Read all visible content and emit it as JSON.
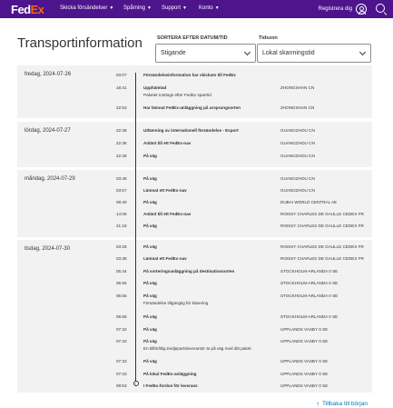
{
  "header": {
    "logo_fed": "Fed",
    "logo_ex": "Ex",
    "nav": [
      "Skicka försändelser",
      "Spårning",
      "Support",
      "Konto"
    ],
    "register": "Registrera dig"
  },
  "page": {
    "title": "Transportinformation",
    "sort_label": "SORTERA EFTER DATUM/TID",
    "sort_value": "Stigande",
    "tz_label": "Tidszon",
    "tz_value": "Lokal skanningstid",
    "back_to_top": "Tillbaka till början"
  },
  "days": [
    {
      "label": "fredag, 2024-07-26",
      "events": [
        {
          "time": "03:07",
          "desc": "Försändelseinformation har skickats till FedEx",
          "loc": ""
        },
        {
          "time": "18:41",
          "desc": "Upphämtad",
          "sub": "Paketet mottogs efter FedEx sparrtid",
          "loc": "ZHONGSHAN CN"
        },
        {
          "time": "22:53",
          "desc": "Har lämnat FedEx-anläggning på ursprungsorten",
          "loc": "ZHONGSHAN CN"
        }
      ]
    },
    {
      "label": "lördag, 2024-07-27",
      "events": [
        {
          "time": "22:38",
          "desc": "Utlämning av internationell försändelse - Export",
          "loc": "GUANGZHOU CN"
        },
        {
          "time": "22:38",
          "desc": "Anlänt till ett FedEx-nav",
          "loc": "GUANGZHOU CN"
        },
        {
          "time": "22:38",
          "desc": "På väg",
          "loc": "GUANGZHOU CN"
        }
      ]
    },
    {
      "label": "måndag, 2024-07-29",
      "events": [
        {
          "time": "03:48",
          "desc": "På väg",
          "loc": "GUANGZHOU CN"
        },
        {
          "time": "03:57",
          "desc": "Lämnat ett FedEx-nav",
          "loc": "GUANGZHOU CN"
        },
        {
          "time": "08:40",
          "desc": "På väg",
          "loc": "DUBAI WORLD CENTRAL AE"
        },
        {
          "time": "14:08",
          "desc": "Anlänt till ett FedEx-nav",
          "loc": "ROISSY CHARLES DE GAULLE CEDEX FR"
        },
        {
          "time": "21:18",
          "desc": "På väg",
          "loc": "ROISSY CHARLES DE GAULLE CEDEX FR"
        }
      ]
    },
    {
      "label": "tisdag, 2024-07-30",
      "events": [
        {
          "time": "03:28",
          "desc": "På väg",
          "loc": "ROISSY CHARLES DE GAULLE CEDEX FR"
        },
        {
          "time": "03:38",
          "desc": "Lämnat ett FedEx-nav",
          "loc": "ROISSY CHARLES DE GAULLE CEDEX FR"
        },
        {
          "time": "05:44",
          "desc": "På sorteringsanläggning på destinationsorten",
          "loc": "STOCKHOLM-ARLANDA 0 SE"
        },
        {
          "time": "05:55",
          "desc": "På väg",
          "loc": "STOCKHOLM-ARLANDA 0 SE"
        },
        {
          "time": "05:55",
          "desc": "På väg",
          "sub": "Försändelse tillgänglig för klarering",
          "loc": "STOCKHOLM-ARLANDA 0 SE"
        },
        {
          "time": "05:56",
          "desc": "På väg",
          "loc": "STOCKHOLM-ARLANDA 0 SE"
        },
        {
          "time": "07:32",
          "desc": "På väg",
          "loc": "UPPLANDS VASBY 0 SE"
        },
        {
          "time": "07:33",
          "desc": "På väg",
          "sub": "En tillförlitlig tredjepartsleverantör är på väg med ditt paket.",
          "loc": "UPPLANDS VASBY 0 SE"
        },
        {
          "time": "07:33",
          "desc": "På väg",
          "loc": "UPPLANDS VASBY 0 SE"
        },
        {
          "time": "07:33",
          "desc": "På lokal FedEx-anläggning",
          "loc": "UPPLANDS VASBY 0 SE"
        },
        {
          "time": "09:53",
          "desc": "I FedEx-fordon för leverans",
          "loc": "UPPLANDS VASBY 0 SE"
        }
      ]
    }
  ],
  "colors": {
    "brand_purple": "#4d148c",
    "brand_orange": "#ff6200",
    "link_blue": "#007ab7"
  }
}
